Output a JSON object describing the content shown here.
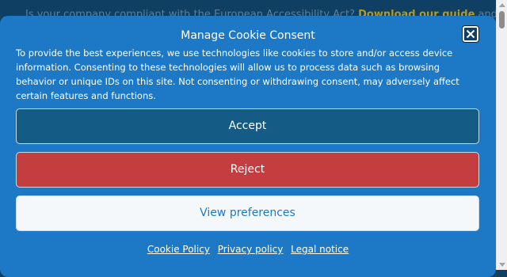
{
  "page": {
    "banner_text": "Is your company compliant with the European Accessibility Act?",
    "banner_link": "Download our guide",
    "banner_after": "and"
  },
  "consent": {
    "title": "Manage Cookie Consent",
    "message": "To provide the best experiences, we use technologies like cookies to store and/or access device information. Consenting to these technologies will allow us to process data such as browsing behavior or unique IDs on this site. Not consenting or withdrawing consent, may adversely affect certain features and functions.",
    "accept_label": "Accept",
    "reject_label": "Reject",
    "preferences_label": "View preferences",
    "links": {
      "cookie_policy": "Cookie Policy",
      "privacy_policy": "Privacy policy",
      "legal_notice": "Legal notice"
    },
    "close_icon": "close-icon"
  },
  "colors": {
    "banner_bg": "#1d79c5",
    "accept_bg": "#145b86",
    "reject_bg": "#c43d3f",
    "preferences_bg": "#f5f8fa",
    "page_bg": "#0f3f63"
  }
}
